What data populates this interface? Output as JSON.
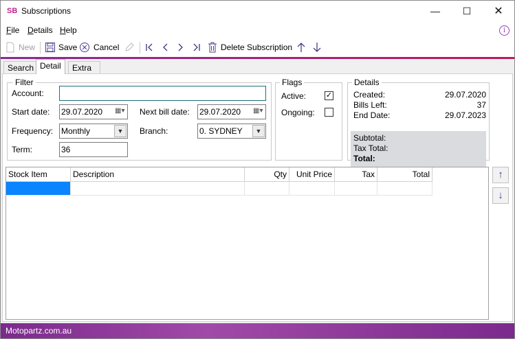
{
  "window": {
    "logo": "SB",
    "title": "Subscriptions",
    "minimize_icon": "minimize-icon",
    "maximize_icon": "maximize-icon",
    "close_icon": "close-icon"
  },
  "menu": {
    "items": [
      {
        "label": "File",
        "accel": "F",
        "rest": "ile"
      },
      {
        "label": "Details",
        "accel": "D",
        "rest": "etails"
      },
      {
        "label": "Help",
        "accel": "H",
        "rest": "elp"
      }
    ],
    "info_icon": "info-icon"
  },
  "toolbar": {
    "new_label": "New",
    "save_label": "Save",
    "cancel_label": "Cancel",
    "delete_label": "Delete Subscription",
    "icons": [
      "new-document-icon",
      "save-icon",
      "cancel-icon",
      "edit-pencil-icon",
      "first-record-icon",
      "previous-record-icon",
      "next-record-icon",
      "last-record-icon",
      "trash-icon",
      "move-up-arrow-icon",
      "move-down-arrow-icon"
    ]
  },
  "tabs": [
    {
      "label": "Search",
      "active": false
    },
    {
      "label": "Detail",
      "active": true
    },
    {
      "label": "Extra",
      "active": false
    }
  ],
  "filter": {
    "title": "Filter",
    "account_label": "Account:",
    "account_value": "",
    "start_date_label": "Start date:",
    "start_date_value": "29.07.2020",
    "next_bill_label": "Next bill date:",
    "next_bill_value": "29.07.2020",
    "frequency_label": "Frequency:",
    "frequency_value": "Monthly",
    "branch_label": "Branch:",
    "branch_value": "0. SYDNEY",
    "term_label": "Term:",
    "term_value": "36"
  },
  "flags": {
    "title": "Flags",
    "active_label": "Active:",
    "active_checked": true,
    "ongoing_label": "Ongoing:",
    "ongoing_checked": false
  },
  "details": {
    "title": "Details",
    "created_label": "Created:",
    "created_value": "29.07.2020",
    "bills_left_label": "Bills Left:",
    "bills_left_value": "37",
    "end_date_label": "End Date:",
    "end_date_value": "29.07.2023",
    "subtotal_label": "Subtotal:",
    "tax_total_label": "Tax Total:",
    "total_label": "Total:"
  },
  "grid": {
    "columns": [
      "Stock Item",
      "Description",
      "Qty",
      "Unit Price",
      "Tax",
      "Total"
    ],
    "rows": []
  },
  "status": {
    "text": "Motopartz.com.au"
  },
  "colors": {
    "accent_purple": "#8a2a9a",
    "accent_pink": "#c2185b",
    "selection_blue": "#0a84ff",
    "totals_bg": "#d9dbde"
  }
}
